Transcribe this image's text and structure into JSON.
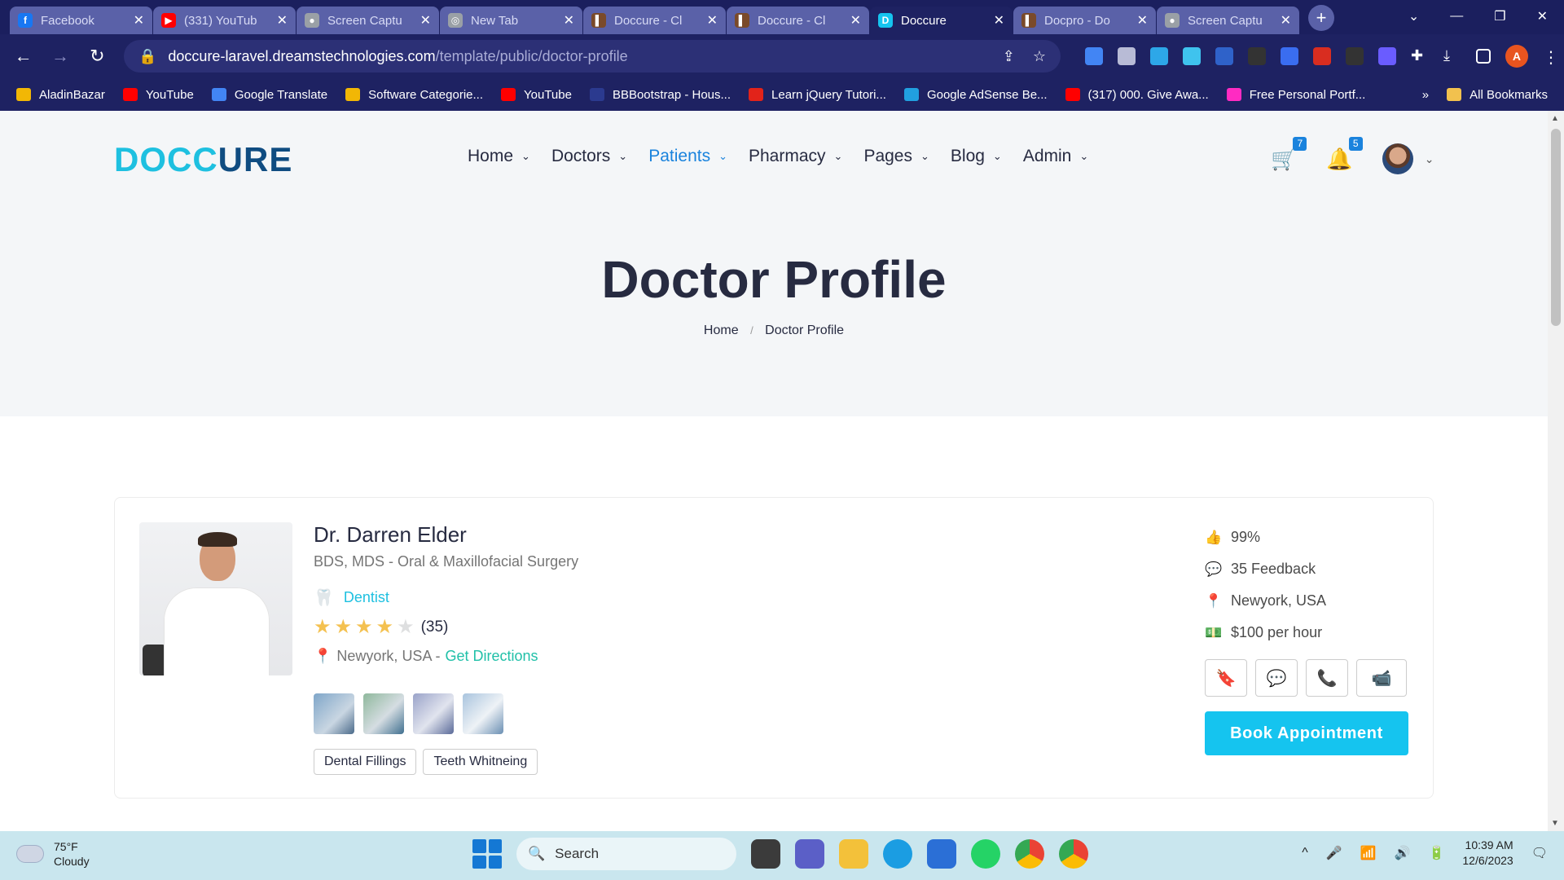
{
  "browser": {
    "tabs": [
      {
        "label": "Facebook",
        "color": "#1877f2",
        "glyph": "f"
      },
      {
        "label": "(331) YouTub",
        "color": "#ff0000",
        "glyph": "▶"
      },
      {
        "label": "Screen Captu",
        "color": "#9aa0a6",
        "glyph": "●"
      },
      {
        "label": "New Tab",
        "color": "#9aa0a6",
        "glyph": "◎"
      },
      {
        "label": "Doccure - Cl",
        "color": "#7a4a2a",
        "glyph": "▌"
      },
      {
        "label": "Doccure - Cl",
        "color": "#7a4a2a",
        "glyph": "▌"
      },
      {
        "label": "Doccure",
        "color": "#15c4ef",
        "glyph": "D"
      },
      {
        "label": "Docpro - Do",
        "color": "#7a4a2a",
        "glyph": "▌"
      },
      {
        "label": "Screen Captu",
        "color": "#9aa0a6",
        "glyph": "●"
      }
    ],
    "active_tab_index": 6,
    "url_host": "doccure-laravel.dreamstechnologies.com",
    "url_path": "/template/public/doctor-profile",
    "bookmarks": [
      {
        "label": "AladinBazar",
        "color": "#f2b705"
      },
      {
        "label": "YouTube",
        "color": "#ff0000"
      },
      {
        "label": "Google Translate",
        "color": "#4285f4"
      },
      {
        "label": "Software Categorie...",
        "color": "#f2b705"
      },
      {
        "label": "YouTube",
        "color": "#ff0000"
      },
      {
        "label": "BBBootstrap - Hous...",
        "color": "#2b3a8f"
      },
      {
        "label": "Learn jQuery Tutori...",
        "color": "#e2231a"
      },
      {
        "label": "Google AdSense Be...",
        "color": "#21a0e0"
      },
      {
        "label": "(317) 000. Give Awa...",
        "color": "#ff0000"
      },
      {
        "label": "Free Personal Portf...",
        "color": "#ff2bc2"
      }
    ],
    "all_bookmarks": "All Bookmarks",
    "profile_initial": "A"
  },
  "site": {
    "logo_part1": "DOCC",
    "logo_part2": "URE",
    "nav": [
      {
        "label": "Home",
        "active": false
      },
      {
        "label": "Doctors",
        "active": false
      },
      {
        "label": "Patients",
        "active": true
      },
      {
        "label": "Pharmacy",
        "active": false
      },
      {
        "label": "Pages",
        "active": false
      },
      {
        "label": "Blog",
        "active": false
      },
      {
        "label": "Admin",
        "active": false
      }
    ],
    "cart_count": "7",
    "notification_count": "5"
  },
  "hero": {
    "title": "Doctor Profile",
    "breadcrumb_home": "Home",
    "breadcrumb_sep": "/",
    "breadcrumb_current": "Doctor Profile"
  },
  "doctor": {
    "name": "Dr. Darren Elder",
    "qualifications": "BDS, MDS - Oral & Maxillofacial Surgery",
    "speciality": "Dentist",
    "rating_stars": 4,
    "rating_max": 5,
    "review_count": "(35)",
    "location": "Newyork, USA - ",
    "directions": "Get Directions",
    "services": [
      "Dental Fillings",
      "Teeth Whitneing"
    ],
    "stats": [
      {
        "icon": "thumbs-up-icon",
        "glyph": "👍",
        "text": "99%"
      },
      {
        "icon": "comment-icon",
        "glyph": "💬",
        "text": "35 Feedback"
      },
      {
        "icon": "map-pin-icon",
        "glyph": "📍",
        "text": "Newyork, USA"
      },
      {
        "icon": "money-icon",
        "glyph": "💵",
        "text": "$100 per hour"
      }
    ],
    "book_label": "Book Appointment"
  },
  "taskbar": {
    "temp": "75°F",
    "condition": "Cloudy",
    "search": "Search",
    "time": "10:39 AM",
    "date": "12/6/2023"
  }
}
